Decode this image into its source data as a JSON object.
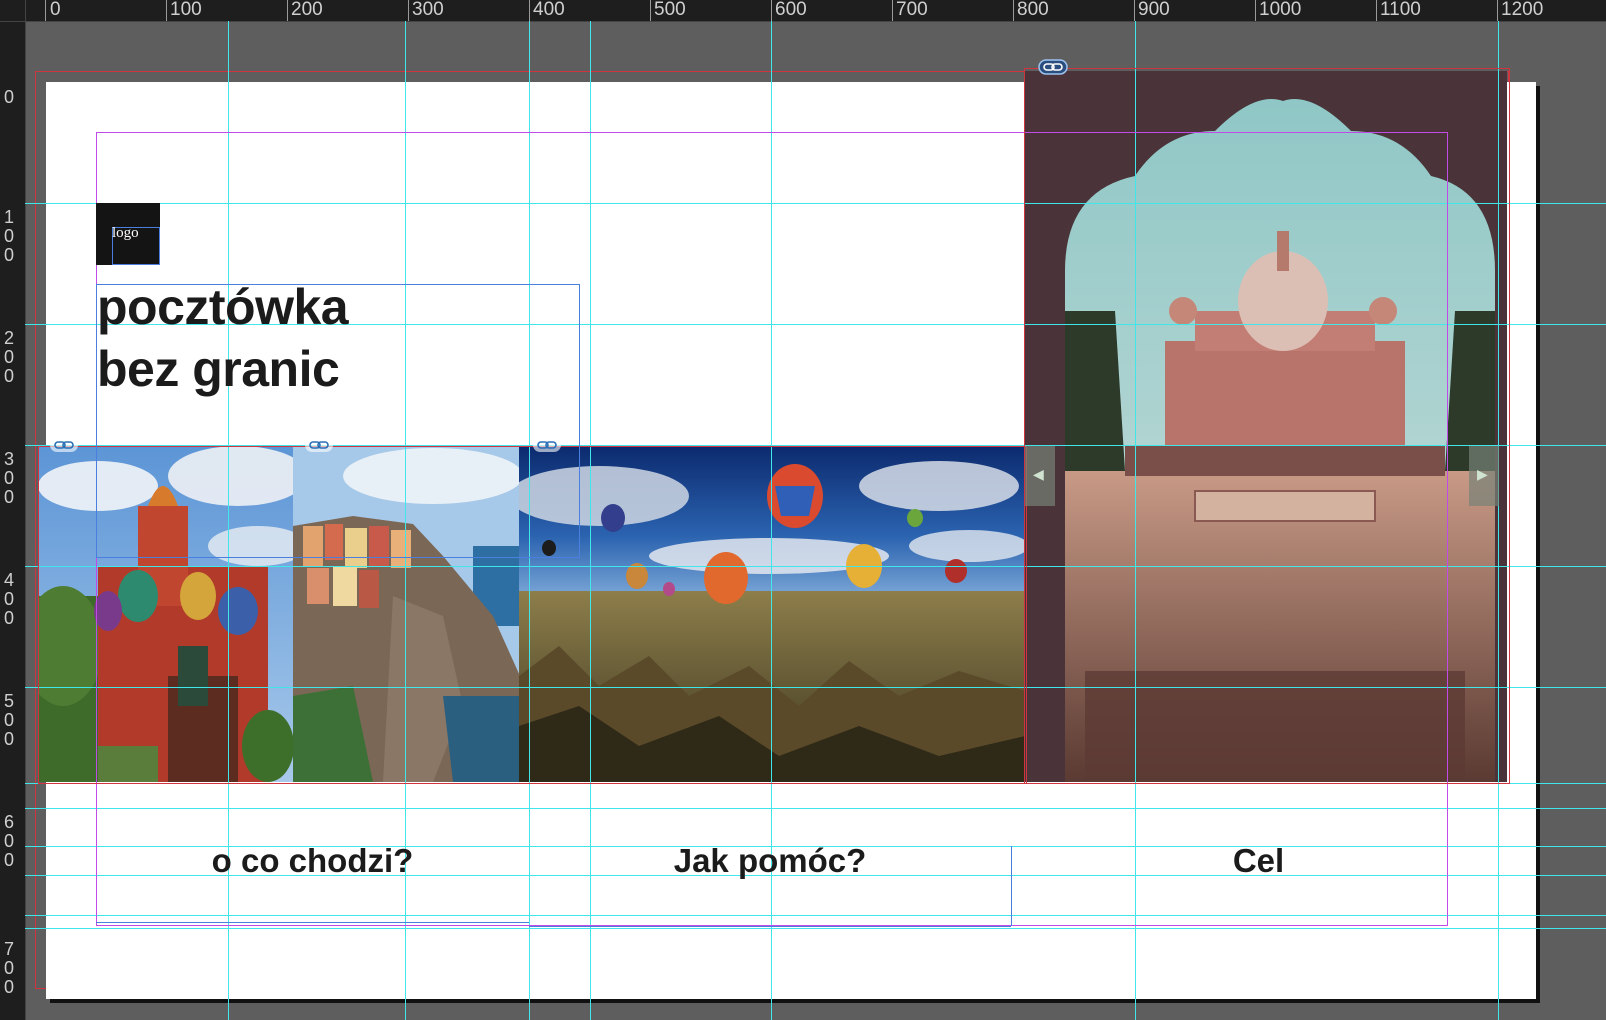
{
  "ruler": {
    "top_labels": [
      "0",
      "100",
      "200",
      "300",
      "400",
      "500",
      "600",
      "700",
      "800",
      "900",
      "1000",
      "1100",
      "1200"
    ],
    "left_labels": [
      "0",
      "1\n0\n0",
      "2\n0\n0",
      "3\n0\n0",
      "4\n0\n0",
      "5\n0\n0",
      "6\n0\n0",
      "7\n0\n0"
    ]
  },
  "document": {
    "logo_text": "logo",
    "headline_line1": "pocztówka",
    "headline_line2": "bez granic",
    "nav": [
      "o co chodzi?",
      "Jak pomóc?",
      "Cel"
    ]
  },
  "images": [
    {
      "name": "moscow-cathedral-photo",
      "icon": "photo"
    },
    {
      "name": "cinque-terre-photo",
      "icon": "photo"
    },
    {
      "name": "cappadocia-balloons-photo",
      "icon": "photo"
    },
    {
      "name": "india-mausoleum-arch-photo",
      "icon": "photo"
    }
  ],
  "colors": {
    "guide": "#3fe6ea",
    "margin": "#c04be8",
    "bleed": "#d0343f",
    "frame": "#4a7fe0",
    "canvas": "#5e5e5e"
  }
}
